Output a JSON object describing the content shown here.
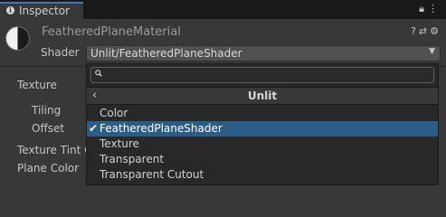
{
  "tab": {
    "label": "Inspector"
  },
  "material": {
    "name": "FeatheredPlaneMaterial"
  },
  "shader": {
    "label": "Shader",
    "value": "Unlit/FeatheredPlaneShader"
  },
  "properties": {
    "texture": "Texture",
    "tiling": "Tiling",
    "offset": "Offset",
    "texture_tint": "Texture Tint C",
    "plane_color": "Plane Color"
  },
  "popup": {
    "search_value": "",
    "breadcrumb": "Unlit",
    "items": [
      {
        "label": "Color",
        "selected": false
      },
      {
        "label": "FeatheredPlaneShader",
        "selected": true
      },
      {
        "label": "Texture",
        "selected": false
      },
      {
        "label": "Transparent",
        "selected": false
      },
      {
        "label": "Transparent Cutout",
        "selected": false
      }
    ]
  },
  "colors": {
    "selection": "#2c5d87",
    "tab_accent": "#3a79bb",
    "background": "#383838"
  }
}
